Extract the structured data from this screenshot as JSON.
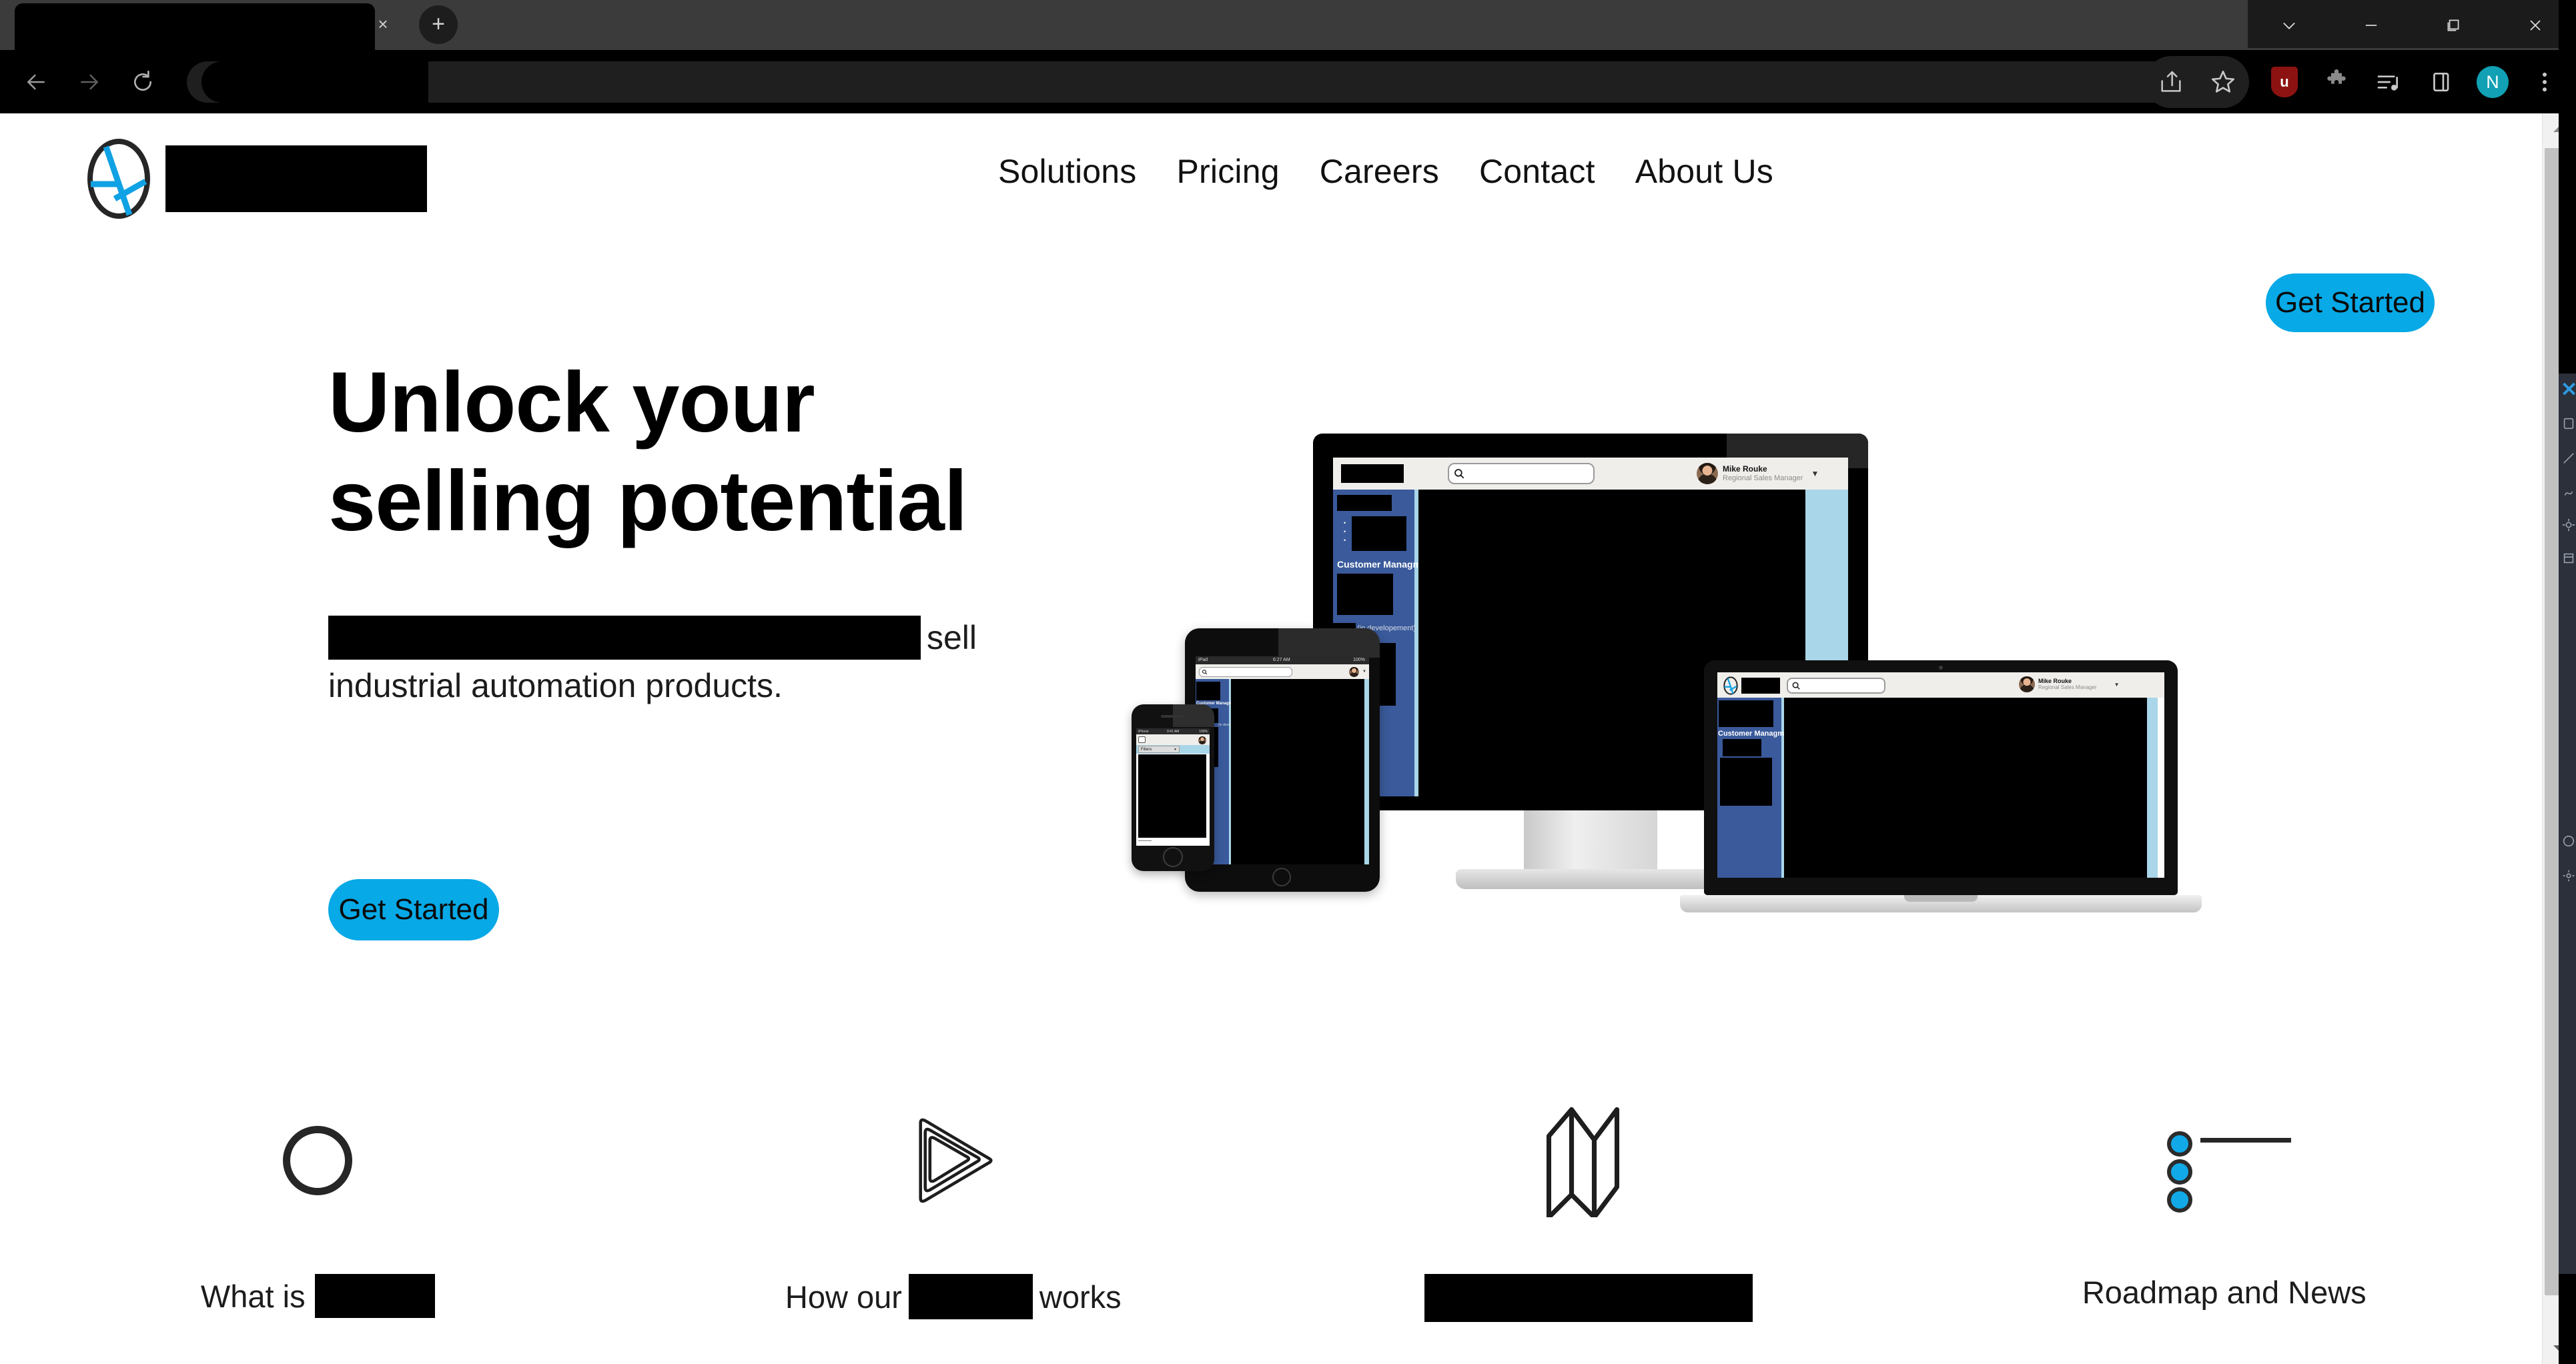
{
  "browser": {
    "tab": {
      "title_redacted": true,
      "close_label": "×"
    },
    "new_tab_label": "+",
    "omnibox": {
      "value_redacted": true,
      "placeholder": ""
    },
    "window_controls": [
      {
        "name": "tab-search",
        "glyph": "⌵"
      },
      {
        "name": "minimize",
        "glyph": "—"
      },
      {
        "name": "maximize",
        "glyph": "❐"
      },
      {
        "name": "close",
        "glyph": "✕"
      }
    ],
    "nav_buttons": [
      {
        "name": "back",
        "glyph": "←"
      },
      {
        "name": "forward",
        "glyph": "→"
      },
      {
        "name": "reload",
        "glyph": "↻"
      }
    ],
    "toolbar_icons": [
      {
        "name": "share-icon",
        "label": "Share"
      },
      {
        "name": "bookmark-star-icon",
        "label": "Bookmark"
      },
      {
        "name": "ublock-origin-icon",
        "label": "uB"
      },
      {
        "name": "extensions-puzzle-icon",
        "label": "Extensions"
      },
      {
        "name": "media-control-icon",
        "label": "Media"
      },
      {
        "name": "side-panel-icon",
        "label": "Side panel"
      },
      {
        "name": "profile-avatar",
        "label": "N"
      },
      {
        "name": "chrome-menu-icon",
        "label": "⋮"
      }
    ]
  },
  "site": {
    "header": {
      "logo_name": "brand-logo",
      "wordmark_redacted": true,
      "nav": [
        {
          "label": "Solutions"
        },
        {
          "label": "Pricing"
        },
        {
          "label": "Careers"
        },
        {
          "label": "Contact"
        },
        {
          "label": "About Us"
        }
      ],
      "cta_label": "Get Started"
    },
    "hero": {
      "title_line1": "Unlock your",
      "title_line2": "selling potential",
      "sub_line1_redacted": true,
      "sub_line1_tail": "sell",
      "sub_line2": "industrial automation products.",
      "cta_label": "Get Started"
    },
    "mockup": {
      "app_user": {
        "name": "Mike Rouke",
        "role": "Regional Sales Manager"
      },
      "sidebar_section": "Customer Managment",
      "sidebar_note": "(in developement)",
      "phone_filter_label": "Filters",
      "phone_status_left": "iPhone",
      "phone_status_center": "9:41 AM",
      "phone_status_right": "100%",
      "tablet_status_left": "iPad",
      "tablet_status_center": "6:27 AM",
      "tablet_status_right": "100%",
      "search_icon": "search-icon"
    },
    "features": [
      {
        "icon": "ring-icon",
        "label_prefix": "What is",
        "label_redacted": true,
        "label_suffix": ""
      },
      {
        "icon": "nested-triangle-play-icon",
        "label_prefix": "How our",
        "label_redacted": true,
        "label_suffix": "works"
      },
      {
        "icon": "folded-map-icon",
        "label_prefix": "",
        "label_redacted": true,
        "label_suffix": ""
      },
      {
        "icon": "roadmap-dots-icon",
        "label_prefix": "Roadmap and News",
        "label_redacted": false,
        "label_suffix": ""
      }
    ]
  },
  "colors": {
    "accent_blue": "#07A9E6",
    "sidebar_blue": "#3A5A9B",
    "panel_light_blue": "#A9D6E8",
    "ink": "#1C1C1C",
    "redaction": "#000000",
    "profile_teal": "#11A0B4",
    "ublock_red": "#8C1212"
  }
}
